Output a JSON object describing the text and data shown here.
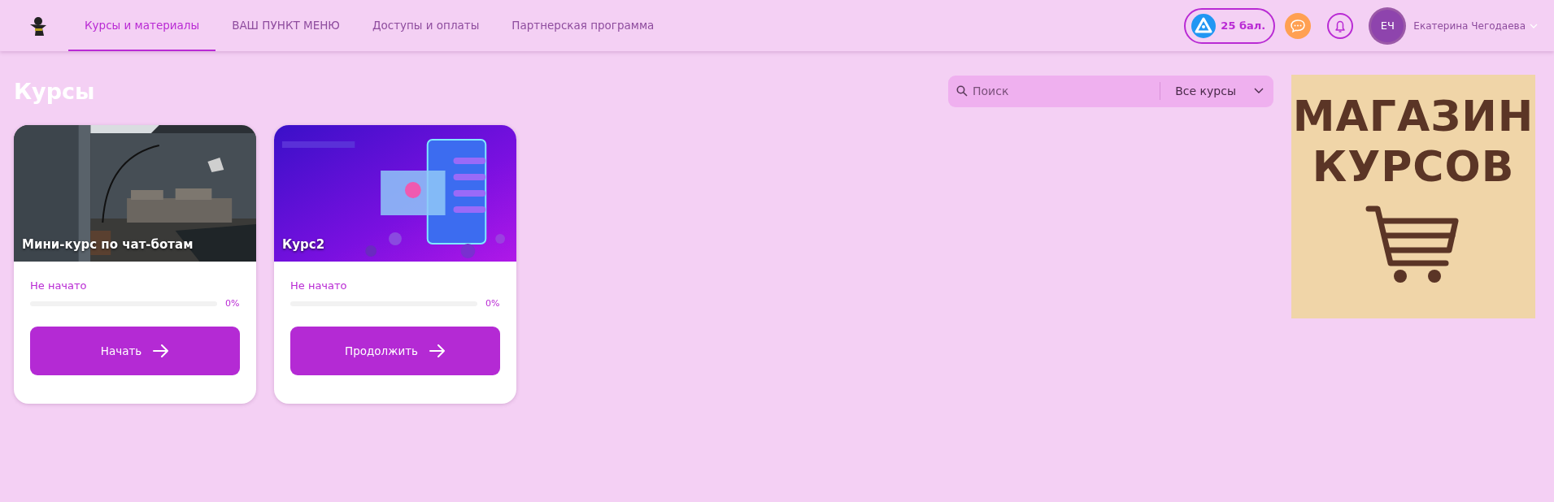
{
  "header": {
    "nav": [
      {
        "label": "Курсы и материалы",
        "selected": true
      },
      {
        "label": "ВАШ ПУНКТ МЕНЮ",
        "selected": false
      },
      {
        "label": "Доступы и оплаты",
        "selected": false
      },
      {
        "label": "Партнерская программа",
        "selected": false
      }
    ],
    "points": "25 бал.",
    "avatar_initials": "ЕЧ",
    "user_name": "Екатерина Чегодаева"
  },
  "page_title": "Курсы",
  "search": {
    "placeholder": "Поиск",
    "filter": "Все курсы"
  },
  "courses": [
    {
      "title": "Мини-курс по чат-ботам",
      "status": "Не начато",
      "level": 0,
      "percent": "0%",
      "button": "Начать"
    },
    {
      "title": "Курс2",
      "status": "Не начато",
      "level": 0,
      "percent": "0%",
      "button": "Продолжить"
    }
  ],
  "shop_banner": {
    "lines": [
      "МАГАЗИН",
      "КУРСОВ"
    ]
  }
}
